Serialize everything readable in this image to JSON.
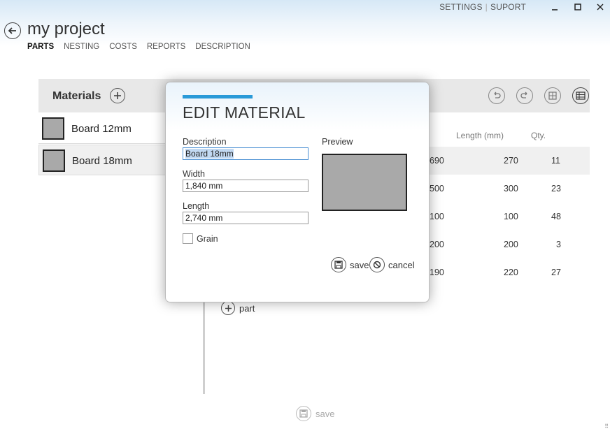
{
  "header": {
    "settings_label": "SETTINGS",
    "support_label": "SUPORT",
    "title": "my project",
    "nav": [
      "PARTS",
      "NESTING",
      "COSTS",
      "REPORTS",
      "DESCRIPTION"
    ]
  },
  "materials": {
    "title": "Materials",
    "items": [
      {
        "label": "Board 12mm"
      },
      {
        "label": "Board 18mm"
      }
    ]
  },
  "parts_table": {
    "columns": {
      "length": "Length (mm)",
      "qty": "Qty."
    },
    "rows": [
      {
        "width_partial": "690",
        "length": "270",
        "qty": "11"
      },
      {
        "width_partial": "500",
        "length": "300",
        "qty": "23"
      },
      {
        "width_partial": "100",
        "length": "100",
        "qty": "48"
      },
      {
        "width_partial": "200",
        "length": "200",
        "qty": "3"
      },
      {
        "width_partial": "190",
        "length": "220",
        "qty": "27"
      }
    ],
    "add_part_label": "part"
  },
  "bottom": {
    "save_label": "save"
  },
  "dialog": {
    "title": "EDIT MATERIAL",
    "description_label": "Description",
    "description_value": "Board 18mm",
    "width_label": "Width",
    "width_value": "1,840 mm",
    "length_label": "Length",
    "length_value": "2,740 mm",
    "preview_label": "Preview",
    "grain_label": "Grain",
    "grain_checked": false,
    "save_label": "save",
    "cancel_label": "cancel"
  },
  "colors": {
    "accent": "#2a9ad8",
    "swatch": "#a9a9a9"
  }
}
